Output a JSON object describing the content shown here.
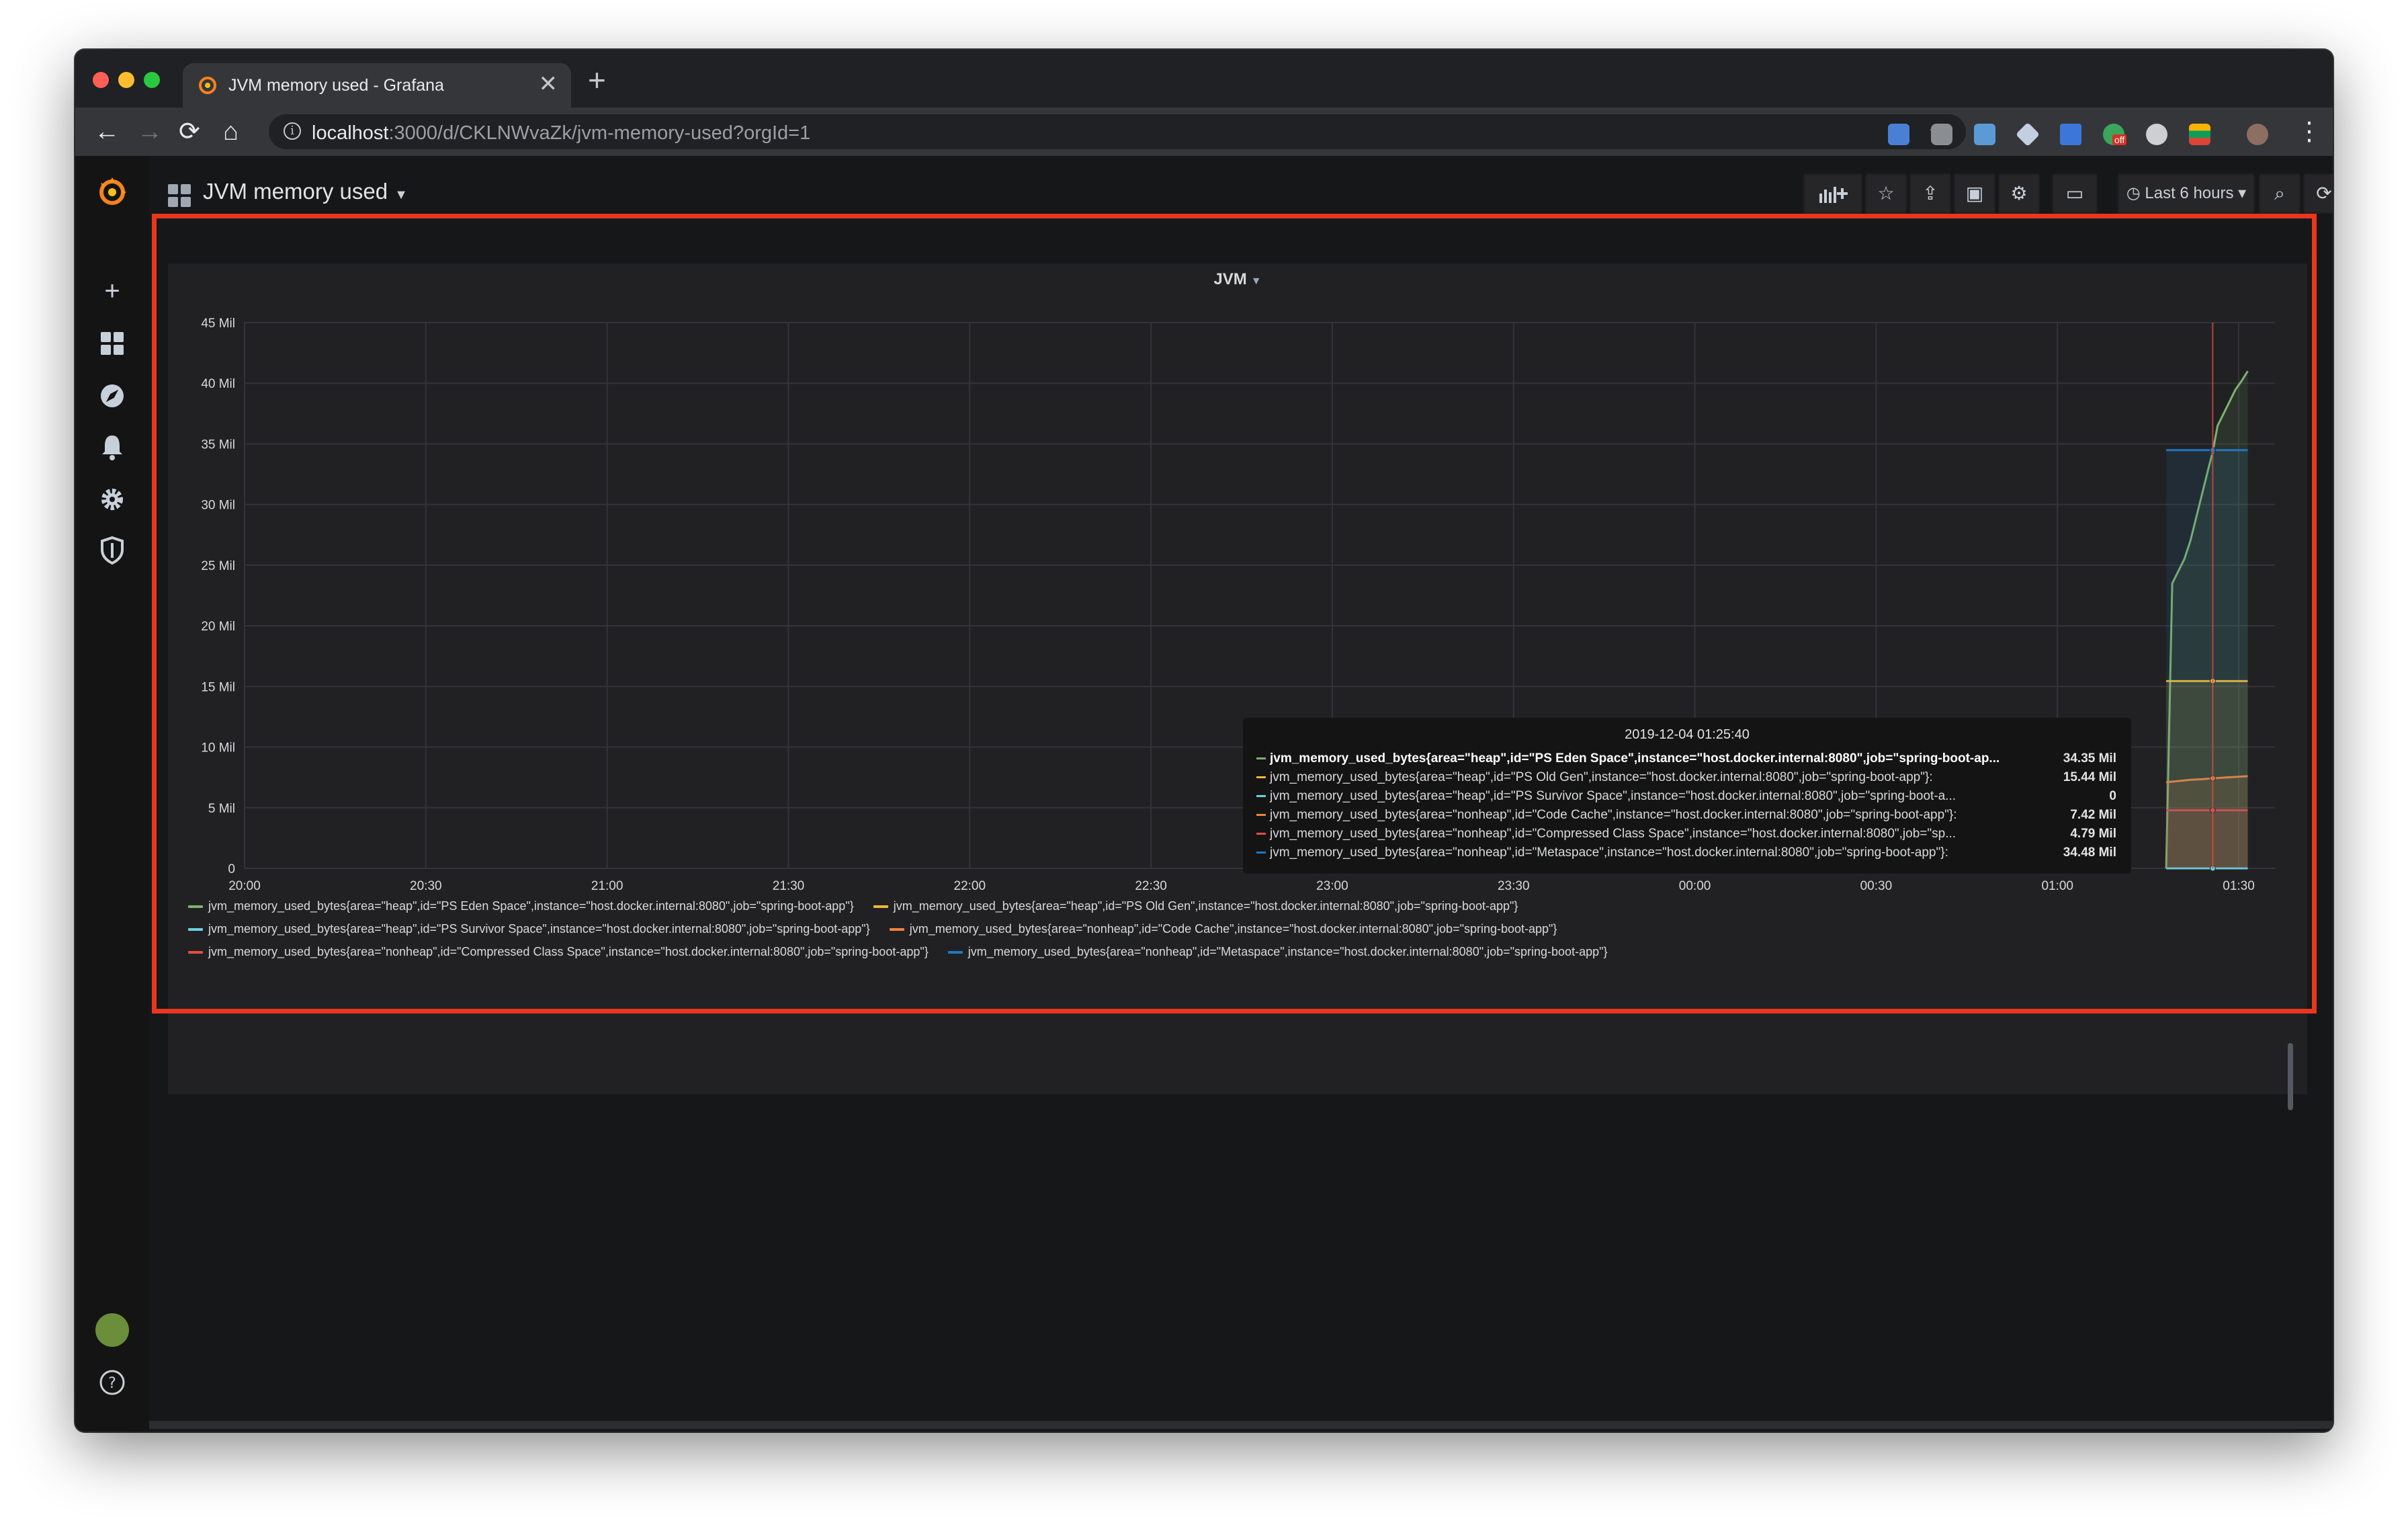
{
  "browser": {
    "tab_title": "JVM memory used - Grafana",
    "tab_close": "✕",
    "new_tab": "+",
    "url_host": "localhost",
    "url_path": ":3000/d/CKLNWvaZk/jvm-memory-used?orgId=1",
    "ext_badge": "off",
    "nav": {
      "back": "←",
      "forward": "→",
      "reload": "⟳",
      "home": "⌂"
    },
    "actions": {
      "zoom": "⌕",
      "star": "☆",
      "menu": "⋮"
    }
  },
  "grafana": {
    "dashboard_title": "JVM memory used",
    "time_range_label": "Last 6 hours",
    "panel_title": "JVM",
    "colors": {
      "eden": "#7eb26d",
      "oldgen": "#eab839",
      "survivor": "#6ed0e0",
      "codecache": "#ef843c",
      "compressed": "#e24d42",
      "metaspace": "#1f78c1",
      "highlight_border": "#e8371d"
    },
    "sidebar_icons": [
      "grafana-logo-icon",
      "plus-icon",
      "dashboards-icon",
      "explore-icon",
      "alerting-bell-icon",
      "configuration-gear-icon",
      "server-admin-shield-icon",
      "user-avatar",
      "help-icon"
    ]
  },
  "tooltip": {
    "time": "2019-12-04 01:25:40",
    "rows": [
      {
        "label": "jvm_memory_used_bytes{area=\"heap\",id=\"PS Eden Space\",instance=\"host.docker.internal:8080\",job=\"spring-boot-ap...",
        "value": "34.35 Mil"
      },
      {
        "label": "jvm_memory_used_bytes{area=\"heap\",id=\"PS Old Gen\",instance=\"host.docker.internal:8080\",job=\"spring-boot-app\"}:",
        "value": "15.44 Mil"
      },
      {
        "label": "jvm_memory_used_bytes{area=\"heap\",id=\"PS Survivor Space\",instance=\"host.docker.internal:8080\",job=\"spring-boot-a...",
        "value": "0"
      },
      {
        "label": "jvm_memory_used_bytes{area=\"nonheap\",id=\"Code Cache\",instance=\"host.docker.internal:8080\",job=\"spring-boot-app\"}:",
        "value": "7.42 Mil"
      },
      {
        "label": "jvm_memory_used_bytes{area=\"nonheap\",id=\"Compressed Class Space\",instance=\"host.docker.internal:8080\",job=\"sp...",
        "value": "4.79 Mil"
      },
      {
        "label": "jvm_memory_used_bytes{area=\"nonheap\",id=\"Metaspace\",instance=\"host.docker.internal:8080\",job=\"spring-boot-app\"}:",
        "value": "34.48 Mil"
      }
    ]
  },
  "legend": [
    [
      {
        "label": "jvm_memory_used_bytes{area=\"heap\",id=\"PS Eden Space\",instance=\"host.docker.internal:8080\",job=\"spring-boot-app\"}"
      },
      {
        "label": "jvm_memory_used_bytes{area=\"heap\",id=\"PS Old Gen\",instance=\"host.docker.internal:8080\",job=\"spring-boot-app\"}"
      }
    ],
    [
      {
        "label": "jvm_memory_used_bytes{area=\"heap\",id=\"PS Survivor Space\",instance=\"host.docker.internal:8080\",job=\"spring-boot-app\"}"
      },
      {
        "label": "jvm_memory_used_bytes{area=\"nonheap\",id=\"Code Cache\",instance=\"host.docker.internal:8080\",job=\"spring-boot-app\"}"
      }
    ],
    [
      {
        "label": "jvm_memory_used_bytes{area=\"nonheap\",id=\"Compressed Class Space\",instance=\"host.docker.internal:8080\",job=\"spring-boot-app\"}"
      },
      {
        "label": "jvm_memory_used_bytes{area=\"nonheap\",id=\"Metaspace\",instance=\"host.docker.internal:8080\",job=\"spring-boot-app\"}"
      }
    ]
  ],
  "chart_data": {
    "type": "line",
    "title": "JVM",
    "xlabel": "",
    "ylabel": "",
    "x_ticks": [
      "20:00",
      "20:30",
      "21:00",
      "21:30",
      "22:00",
      "22:30",
      "23:00",
      "23:30",
      "00:00",
      "00:30",
      "01:00",
      "01:30"
    ],
    "y_ticks": [
      "0",
      "5 Mil",
      "10 Mil",
      "15 Mil",
      "20 Mil",
      "25 Mil",
      "30 Mil",
      "35 Mil",
      "40 Mil",
      "45 Mil"
    ],
    "ylim": [
      0,
      45
    ],
    "y_unit": "Mil",
    "x_range_minutes": [
      0,
      336
    ],
    "hover_x_minutes": 325.7,
    "grid": true,
    "legend_position": "bottom",
    "series": [
      {
        "key": "eden",
        "x": [
          318,
          319,
          320,
          321,
          322,
          323,
          324,
          325,
          325.7,
          326.5,
          327.5,
          328.5,
          329.5,
          330.5,
          331.5
        ],
        "values": [
          0.0,
          23.5,
          24.5,
          25.5,
          27.0,
          29.0,
          31.0,
          33.0,
          34.35,
          36.5,
          37.5,
          38.5,
          39.5,
          40.2,
          41.0
        ]
      },
      {
        "key": "oldgen",
        "x": [
          318,
          325.7,
          331.5
        ],
        "values": [
          15.44,
          15.44,
          15.44
        ]
      },
      {
        "key": "survivor",
        "x": [
          318,
          325.7,
          331.5
        ],
        "values": [
          0.0,
          0.0,
          0.0
        ]
      },
      {
        "key": "codecache",
        "x": [
          318,
          320,
          322,
          324,
          325.7,
          328,
          331.5
        ],
        "values": [
          7.1,
          7.2,
          7.3,
          7.35,
          7.42,
          7.5,
          7.6
        ]
      },
      {
        "key": "compressed",
        "x": [
          318,
          325.7,
          331.5
        ],
        "values": [
          4.79,
          4.79,
          4.79
        ]
      },
      {
        "key": "metaspace",
        "x": [
          318,
          325.7,
          331.5
        ],
        "values": [
          34.48,
          34.48,
          34.48
        ]
      }
    ]
  }
}
